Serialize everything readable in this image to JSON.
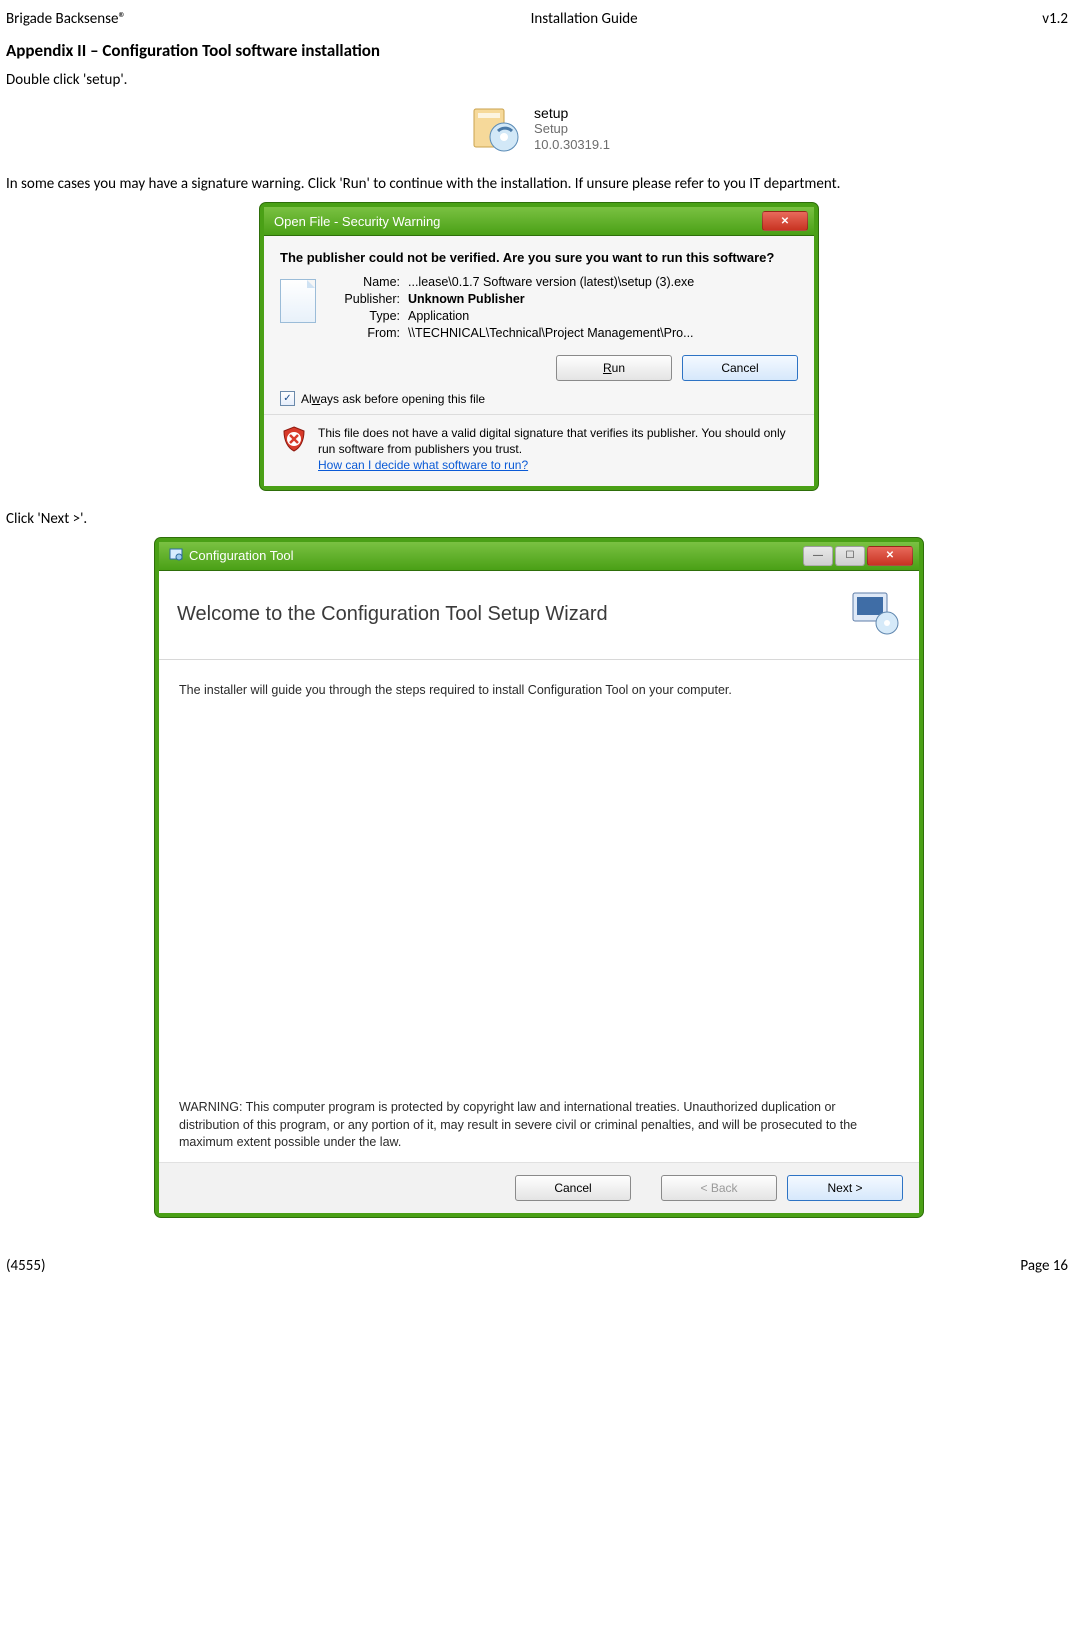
{
  "header": {
    "left": "Brigade Backsense®",
    "center": "Installation Guide",
    "right": "v1.2"
  },
  "appendix_title": "Appendix II – Configuration Tool software installation",
  "step1_text": "Double click 'setup'.",
  "setup": {
    "name": "setup",
    "desc": "Setup",
    "version": "10.0.30319.1"
  },
  "step2_text": "In some cases you may have a signature warning. Click 'Run' to continue with the installation. If unsure please refer to you IT department.",
  "security_dialog": {
    "title": "Open File - Security Warning",
    "heading": "The publisher could not be verified.  Are you sure you want to run this software?",
    "labels": {
      "name": "Name:",
      "publisher": "Publisher:",
      "type": "Type:",
      "from": "From:"
    },
    "values": {
      "name": "...lease\\0.1.7 Software version (latest)\\setup (3).exe",
      "publisher": "Unknown Publisher",
      "type": "Application",
      "from": "\\\\TECHNICAL\\Technical\\Project Management\\Pro..."
    },
    "run_btn": "Run",
    "cancel_btn": "Cancel",
    "always_ask": "Always ask before opening this file",
    "warn_msg": "This file does not have a valid digital signature that verifies its publisher.  You should only run software from publishers you trust.",
    "warn_link": "How can I decide what software to run?"
  },
  "step3_text": "Click 'Next >'.",
  "wizard": {
    "title": "Configuration Tool",
    "welcome": "Welcome to the Configuration Tool Setup Wizard",
    "intro": "The installer will guide you through the steps required to install Configuration Tool on your computer.",
    "warning": "WARNING: This computer program is protected by copyright law and international treaties. Unauthorized duplication or distribution of this program, or any portion of it, may result in severe civil or criminal penalties, and will be prosecuted to the maximum extent possible under the law.",
    "cancel": "Cancel",
    "back": "< Back",
    "next": "Next >"
  },
  "footer": {
    "left": "(4555)",
    "right": "Page 16"
  }
}
